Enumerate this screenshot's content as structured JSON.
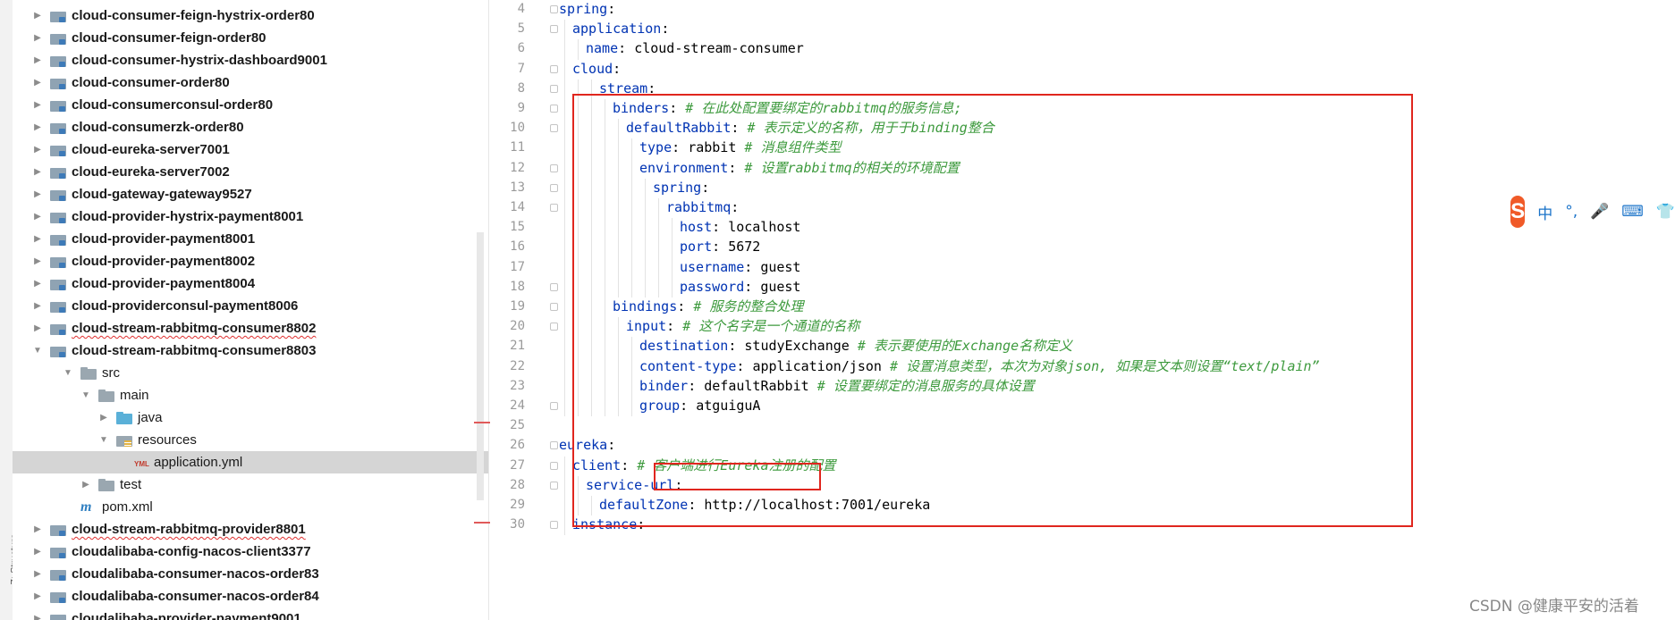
{
  "sidebar": {
    "structure_label": "Z: Structure",
    "tree": [
      {
        "label": "cloud-consumer-feign-hystrix-order80",
        "kind": "module",
        "expanded": false,
        "bold": true,
        "squiggle": false
      },
      {
        "label": "cloud-consumer-feign-order80",
        "kind": "module",
        "expanded": false,
        "bold": true,
        "squiggle": false
      },
      {
        "label": "cloud-consumer-hystrix-dashboard9001",
        "kind": "module",
        "expanded": false,
        "bold": true,
        "squiggle": false
      },
      {
        "label": "cloud-consumer-order80",
        "kind": "module",
        "expanded": false,
        "bold": true,
        "squiggle": false
      },
      {
        "label": "cloud-consumerconsul-order80",
        "kind": "module",
        "expanded": false,
        "bold": true,
        "squiggle": false
      },
      {
        "label": "cloud-consumerzk-order80",
        "kind": "module",
        "expanded": false,
        "bold": true,
        "squiggle": false
      },
      {
        "label": "cloud-eureka-server7001",
        "kind": "module",
        "expanded": false,
        "bold": true,
        "squiggle": false
      },
      {
        "label": "cloud-eureka-server7002",
        "kind": "module",
        "expanded": false,
        "bold": true,
        "squiggle": false
      },
      {
        "label": "cloud-gateway-gateway9527",
        "kind": "module",
        "expanded": false,
        "bold": true,
        "squiggle": false
      },
      {
        "label": "cloud-provider-hystrix-payment8001",
        "kind": "module",
        "expanded": false,
        "bold": true,
        "squiggle": false
      },
      {
        "label": "cloud-provider-payment8001",
        "kind": "module",
        "expanded": false,
        "bold": true,
        "squiggle": false
      },
      {
        "label": "cloud-provider-payment8002",
        "kind": "module",
        "expanded": false,
        "bold": true,
        "squiggle": false
      },
      {
        "label": "cloud-provider-payment8004",
        "kind": "module",
        "expanded": false,
        "bold": true,
        "squiggle": false
      },
      {
        "label": "cloud-providerconsul-payment8006",
        "kind": "module",
        "expanded": false,
        "bold": true,
        "squiggle": false
      },
      {
        "label": "cloud-stream-rabbitmq-consumer8802",
        "kind": "module",
        "expanded": false,
        "bold": true,
        "squiggle": true
      },
      {
        "label": "cloud-stream-rabbitmq-consumer8803",
        "kind": "module",
        "expanded": true,
        "bold": true,
        "squiggle": false
      },
      {
        "label": "src",
        "kind": "folder",
        "expanded": true,
        "bold": false,
        "squiggle": false
      },
      {
        "label": "main",
        "kind": "folder",
        "expanded": true,
        "bold": false,
        "squiggle": false
      },
      {
        "label": "java",
        "kind": "src-folder",
        "expanded": false,
        "bold": false,
        "squiggle": false
      },
      {
        "label": "resources",
        "kind": "res-folder",
        "expanded": true,
        "bold": false,
        "squiggle": false
      },
      {
        "label": "application.yml",
        "kind": "yml",
        "expanded": null,
        "bold": false,
        "squiggle": false,
        "selected": true
      },
      {
        "label": "test",
        "kind": "folder",
        "expanded": false,
        "bold": false,
        "squiggle": false
      },
      {
        "label": "pom.xml",
        "kind": "maven",
        "expanded": null,
        "bold": false,
        "squiggle": false
      },
      {
        "label": "cloud-stream-rabbitmq-provider8801",
        "kind": "module",
        "expanded": false,
        "bold": true,
        "squiggle": true
      },
      {
        "label": "cloudalibaba-config-nacos-client3377",
        "kind": "module",
        "expanded": false,
        "bold": true,
        "squiggle": false
      },
      {
        "label": "cloudalibaba-consumer-nacos-order83",
        "kind": "module",
        "expanded": false,
        "bold": true,
        "squiggle": false
      },
      {
        "label": "cloudalibaba-consumer-nacos-order84",
        "kind": "module",
        "expanded": false,
        "bold": true,
        "squiggle": false
      },
      {
        "label": "cloudalibaba-provider-payment9001",
        "kind": "module",
        "expanded": false,
        "bold": true,
        "squiggle": false
      }
    ]
  },
  "editor": {
    "lines": [
      {
        "num": "4",
        "key": "spring",
        "sep": ":",
        "value": "",
        "comment": ""
      },
      {
        "num": "5",
        "key": "application",
        "sep": ":",
        "value": "",
        "comment": ""
      },
      {
        "num": "6",
        "key": "name",
        "sep": ": ",
        "value": "cloud-stream-consumer",
        "comment": ""
      },
      {
        "num": "7",
        "key": "cloud",
        "sep": ":",
        "value": "",
        "comment": ""
      },
      {
        "num": "8",
        "key": "stream",
        "sep": ":",
        "value": "",
        "comment": ""
      },
      {
        "num": "9",
        "key": "binders",
        "sep": ": ",
        "value": "",
        "comment": "# 在此处配置要绑定的rabbitmq的服务信息;"
      },
      {
        "num": "10",
        "key": "defaultRabbit",
        "sep": ": ",
        "value": "",
        "comment": "# 表示定义的名称，用于于binding整合"
      },
      {
        "num": "11",
        "key": "type",
        "sep": ": ",
        "value": "rabbit ",
        "comment": "# 消息组件类型"
      },
      {
        "num": "12",
        "key": "environment",
        "sep": ": ",
        "value": "",
        "comment": "# 设置rabbitmq的相关的环境配置"
      },
      {
        "num": "13",
        "key": "spring",
        "sep": ":",
        "value": "",
        "comment": ""
      },
      {
        "num": "14",
        "key": "rabbitmq",
        "sep": ":",
        "value": "",
        "comment": ""
      },
      {
        "num": "15",
        "key": "host",
        "sep": ": ",
        "value": "localhost",
        "comment": ""
      },
      {
        "num": "16",
        "key": "port",
        "sep": ": ",
        "value": "5672",
        "comment": ""
      },
      {
        "num": "17",
        "key": "username",
        "sep": ": ",
        "value": "guest",
        "comment": ""
      },
      {
        "num": "18",
        "key": "password",
        "sep": ": ",
        "value": "guest",
        "comment": ""
      },
      {
        "num": "19",
        "key": "bindings",
        "sep": ": ",
        "value": "",
        "comment": "# 服务的整合处理"
      },
      {
        "num": "20",
        "key": "input",
        "sep": ": ",
        "value": "",
        "comment": "# 这个名字是一个通道的名称"
      },
      {
        "num": "21",
        "key": "destination",
        "sep": ": ",
        "value": "studyExchange ",
        "comment": "# 表示要使用的Exchange名称定义"
      },
      {
        "num": "22",
        "key": "content-type",
        "sep": ": ",
        "value": "application/json ",
        "comment": "# 设置消息类型，本次为对象json, 如果是文本则设置“text/plain”"
      },
      {
        "num": "23",
        "key": "binder",
        "sep": ": ",
        "value": "defaultRabbit ",
        "comment": "# 设置要绑定的消息服务的具体设置"
      },
      {
        "num": "24",
        "key": "group",
        "sep": ": ",
        "value": "atguiguA",
        "comment": ""
      },
      {
        "num": "25",
        "key": "",
        "sep": "",
        "value": "",
        "comment": ""
      },
      {
        "num": "26",
        "key": "eureka",
        "sep": ":",
        "value": "",
        "comment": ""
      },
      {
        "num": "27",
        "key": "client",
        "sep": ": ",
        "value": "",
        "comment": "# 客户端进行Eureka注册的配置"
      },
      {
        "num": "28",
        "key": "service-url",
        "sep": ":",
        "value": "",
        "comment": ""
      },
      {
        "num": "29",
        "key": "defaultZone",
        "sep": ": ",
        "value": "http://localhost:7001/eureka",
        "comment": ""
      },
      {
        "num": "30",
        "key": "instance",
        "sep": ":",
        "value": "",
        "comment": ""
      }
    ]
  },
  "ime_toolbar": {
    "logo": "S",
    "items": [
      "中",
      "°,",
      "🎤",
      "⌨",
      "👕"
    ]
  },
  "watermark": "CSDN @健康平安的活着",
  "colors": {
    "highlight_box": "#e0261e",
    "yaml_key": "#0033b3",
    "comment": "#3d9a3d",
    "selection": "#d5d5d5"
  }
}
